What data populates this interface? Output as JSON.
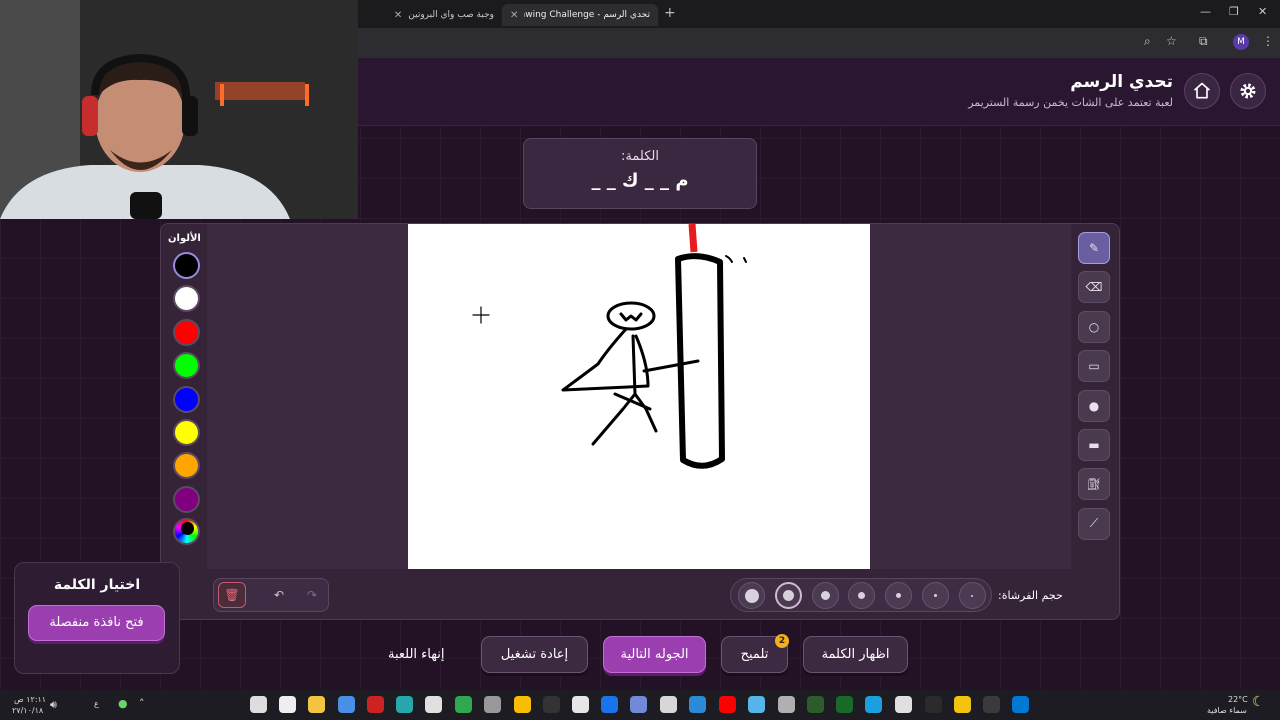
{
  "browser": {
    "tabs": [
      {
        "label": "وجبة صب واي البروتين",
        "active": false
      },
      {
        "label": "تحدي الرسم - Drawing Challenge",
        "active": true
      }
    ],
    "profile_initial": "M"
  },
  "header": {
    "title": "تحدي الرسم",
    "subtitle": "لعبة تعتمد على الشات يخمن رسمة الستريمر"
  },
  "word_card": {
    "label": "الكلمة:",
    "masked_word": "م _ _ ك _ _"
  },
  "palette": {
    "label": "الألوان",
    "colors": [
      "#000000",
      "#ffffff",
      "#ff0000",
      "#00ff00",
      "#0000ff",
      "#ffff00",
      "#ffa500",
      "#800080"
    ],
    "selected_color": "#000000"
  },
  "tools": [
    "pen-icon",
    "eraser-icon",
    "circle-outline-icon",
    "rectangle-outline-icon",
    "circle-filled-icon",
    "rectangle-filled-icon",
    "fill-bucket-icon",
    "line-icon"
  ],
  "brush": {
    "label": "حجم الفرشاة:",
    "selected_index": 1
  },
  "word_choice": {
    "title": "اختيار الكلمة",
    "button": "فتح نافذة منفصلة"
  },
  "actions": {
    "show_word": "اظهار الكلمة",
    "hint": "تلميح",
    "hint_badge": "2",
    "next_round": "الجوله التالية",
    "restart": "إعادة تشغيل",
    "end_game": "إنهاء اللعبة"
  },
  "taskbar": {
    "weather_temp": "22°C",
    "weather_text": "سماء صافية",
    "time": "١٢:١١ ص",
    "date": "٢٧/١٠/١٨",
    "lang": "ع"
  }
}
